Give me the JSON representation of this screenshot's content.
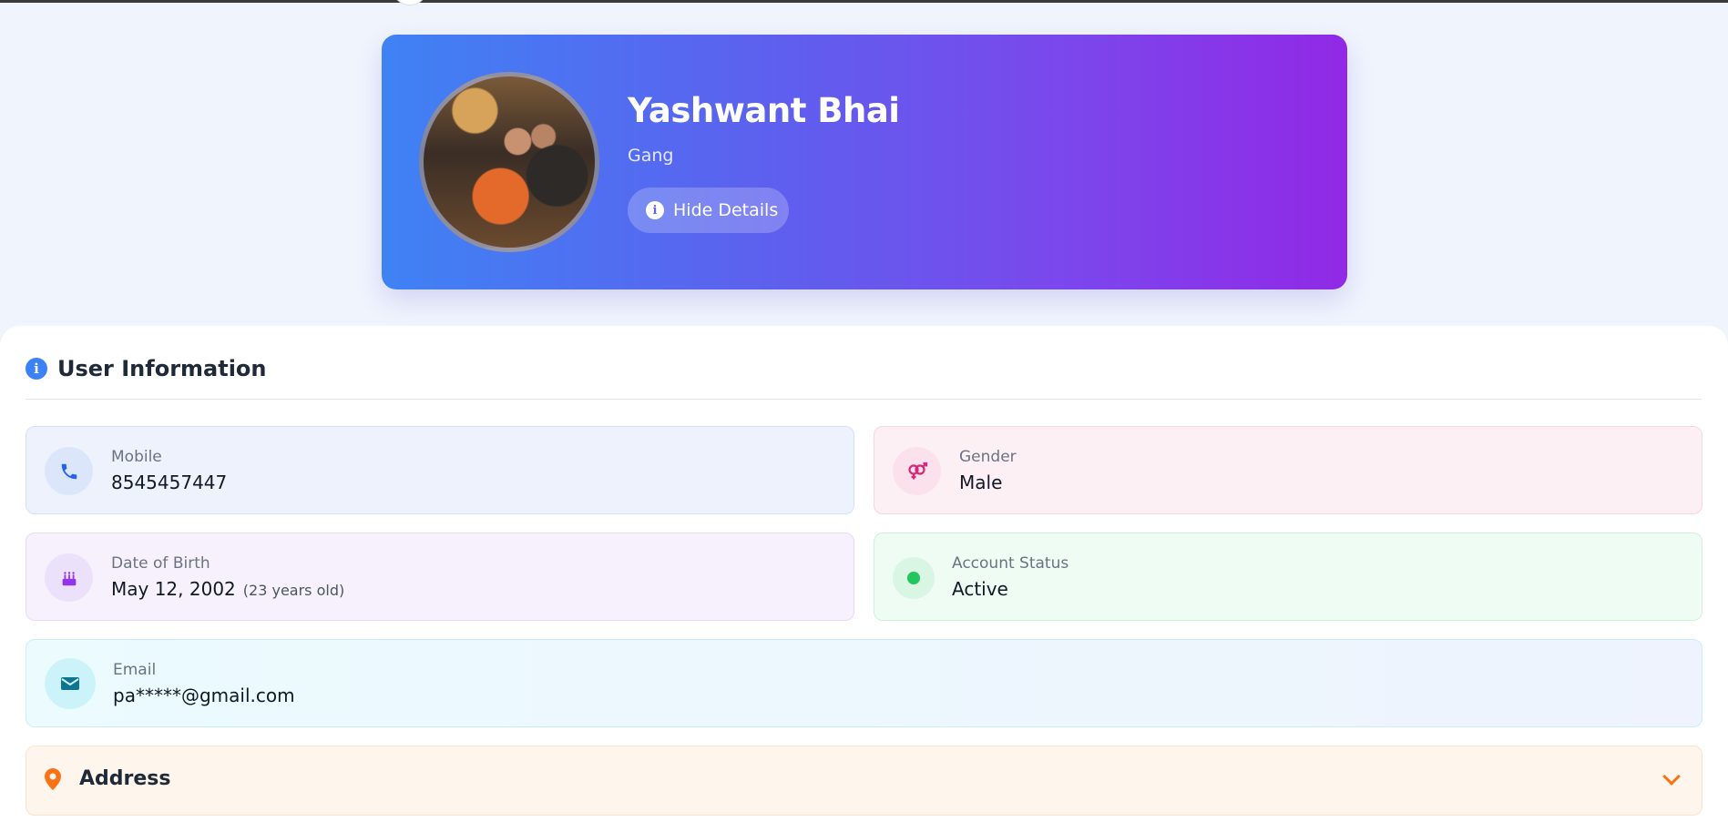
{
  "profile": {
    "name": "Yashwant Bhai",
    "subtitle": "Gang",
    "toggle_details_label": "Hide Details"
  },
  "section": {
    "title": "User Information"
  },
  "fields": {
    "mobile": {
      "label": "Mobile",
      "value": "8545457447"
    },
    "gender": {
      "label": "Gender",
      "value": "Male"
    },
    "dob": {
      "label": "Date of Birth",
      "value": "May 12, 2002",
      "age": "(23 years old)"
    },
    "status": {
      "label": "Account Status",
      "value": "Active"
    },
    "email": {
      "label": "Email",
      "value": "pa*****@gmail.com"
    }
  },
  "address": {
    "label": "Address"
  },
  "icons": {
    "info": "info-icon",
    "mobile": "phone-icon",
    "gender": "gender-icon",
    "dob": "cake-icon",
    "status": "status-dot-icon",
    "email": "mail-icon",
    "address": "map-pin-icon",
    "expand": "chevron-down-icon"
  },
  "colors": {
    "hero_gradient_start": "#3f82f4",
    "hero_gradient_end": "#9129e6",
    "accent_blue": "#3b82f6",
    "status_active": "#22c55e",
    "address_accent": "#f97316"
  }
}
